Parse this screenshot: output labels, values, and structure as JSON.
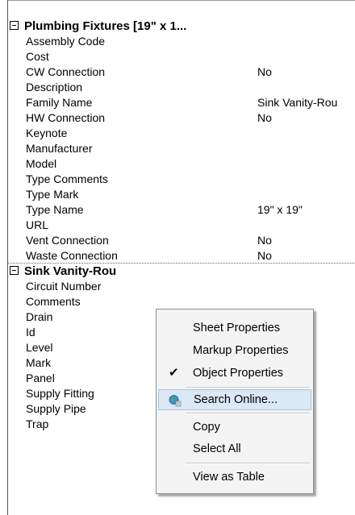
{
  "section1": {
    "title": "Plumbing Fixtures [19\" x 1...",
    "rows": [
      {
        "name": "Assembly Code",
        "value": ""
      },
      {
        "name": "Cost",
        "value": ""
      },
      {
        "name": "CW Connection",
        "value": "No"
      },
      {
        "name": "Description",
        "value": ""
      },
      {
        "name": "Family Name",
        "value": "Sink Vanity-Rou"
      },
      {
        "name": "HW Connection",
        "value": "No"
      },
      {
        "name": "Keynote",
        "value": ""
      },
      {
        "name": "Manufacturer",
        "value": ""
      },
      {
        "name": "Model",
        "value": ""
      },
      {
        "name": "Type Comments",
        "value": ""
      },
      {
        "name": "Type Mark",
        "value": ""
      },
      {
        "name": "Type Name",
        "value": "19\" x 19\""
      },
      {
        "name": "URL",
        "value": ""
      },
      {
        "name": "Vent Connection",
        "value": "No"
      },
      {
        "name": "Waste Connection",
        "value": "No"
      }
    ]
  },
  "section2": {
    "title": "Sink Vanity-Rou",
    "rows": [
      {
        "name": "Circuit Number"
      },
      {
        "name": "Comments"
      },
      {
        "name": "Drain"
      },
      {
        "name": "Id"
      },
      {
        "name": "Level"
      },
      {
        "name": "Mark"
      },
      {
        "name": "Panel"
      },
      {
        "name": "Supply Fitting"
      },
      {
        "name": "Supply Pipe"
      },
      {
        "name": "Trap"
      }
    ]
  },
  "context_menu": {
    "items": [
      {
        "label": "Sheet Properties"
      },
      {
        "label": "Markup Properties"
      },
      {
        "label": "Object Properties",
        "checked": true
      },
      {
        "label": "Search Online...",
        "icon": "globe-search-icon",
        "highlighted": true
      },
      {
        "label": "Copy"
      },
      {
        "label": "Select All"
      },
      {
        "label": "View as Table"
      }
    ]
  }
}
